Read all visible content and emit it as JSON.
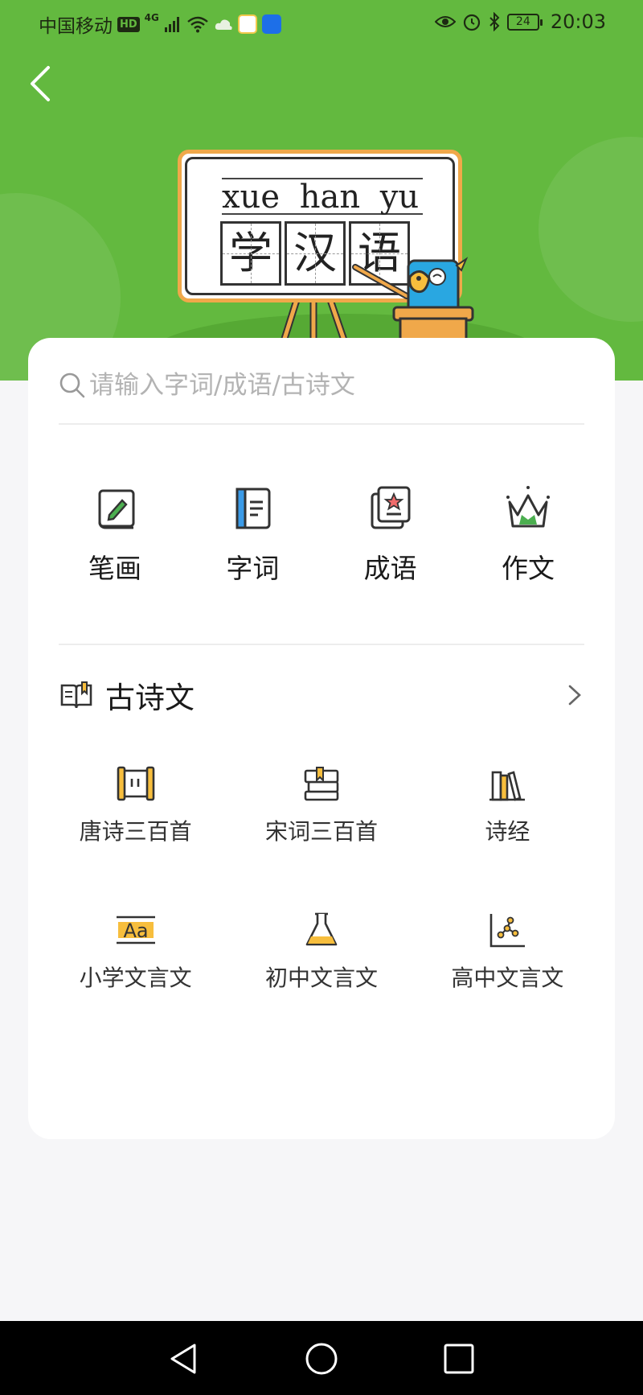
{
  "status_bar": {
    "carrier": "中国移动",
    "hd": "HD",
    "network": "4G",
    "battery": "24",
    "time": "20:03"
  },
  "search": {
    "placeholder": "请输入字词/成语/古诗文"
  },
  "banner": {
    "pinyin": "xue han yu",
    "chars": [
      "学",
      "汉",
      "语"
    ]
  },
  "tools": [
    {
      "label": "笔画",
      "icon": "pencil-book-icon"
    },
    {
      "label": "字词",
      "icon": "notebook-icon"
    },
    {
      "label": "成语",
      "icon": "star-book-icon"
    },
    {
      "label": "作文",
      "icon": "crown-icon"
    }
  ],
  "poetry": {
    "title": "古诗文",
    "items": [
      {
        "label": "唐诗三百首",
        "icon": "scroll-icon"
      },
      {
        "label": "宋词三百首",
        "icon": "book-stack-icon"
      },
      {
        "label": "诗经",
        "icon": "bookshelf-icon"
      },
      {
        "label": "小学文言文",
        "icon": "text-aa-icon"
      },
      {
        "label": "初中文言文",
        "icon": "flask-icon"
      },
      {
        "label": "高中文言文",
        "icon": "chart-icon"
      }
    ]
  },
  "colors": {
    "header_green": "#63b93f",
    "accent_yellow": "#f7be3d",
    "icon_green": "#4caf50"
  }
}
